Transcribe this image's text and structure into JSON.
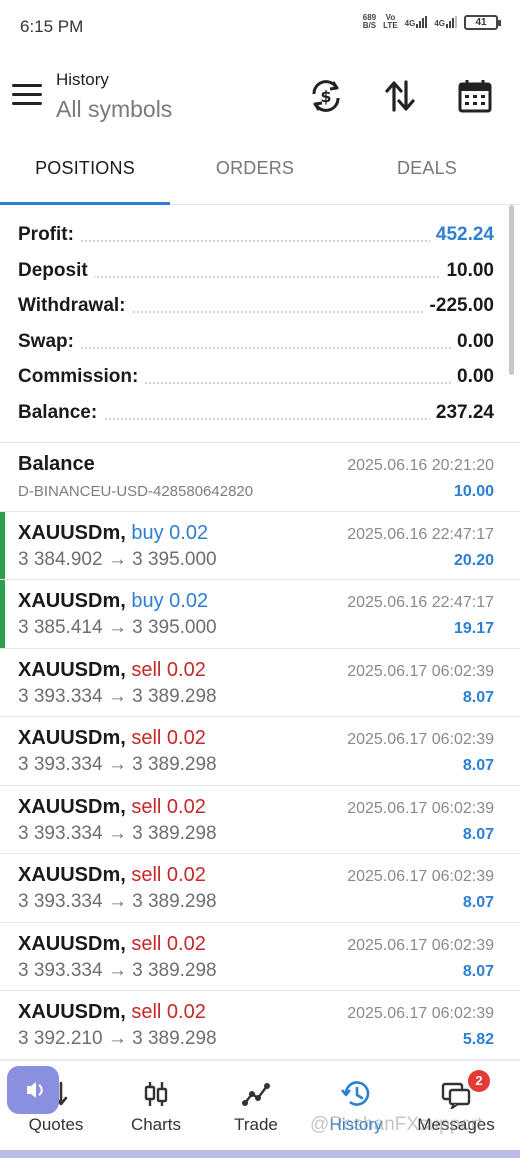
{
  "status_bar": {
    "time": "6:15 PM",
    "speed_value": "689",
    "speed_unit": "B/S",
    "volte_top": "Vo",
    "volte_bottom": "LTE",
    "net1": "4G",
    "net2": "4G",
    "battery": "41"
  },
  "header": {
    "title": "History",
    "subtitle": "All symbols"
  },
  "tabs": [
    {
      "label": "POSITIONS",
      "active": true
    },
    {
      "label": "ORDERS",
      "active": false
    },
    {
      "label": "DEALS",
      "active": false
    }
  ],
  "summary": [
    {
      "label": "Profit:",
      "value": "452.24",
      "color": "#2d7fd3"
    },
    {
      "label": "Deposit",
      "value": "10.00",
      "color": "#1a1a1a"
    },
    {
      "label": "Withdrawal:",
      "value": "-225.00",
      "color": "#1a1a1a"
    },
    {
      "label": "Swap:",
      "value": "0.00",
      "color": "#1a1a1a"
    },
    {
      "label": "Commission:",
      "value": "0.00",
      "color": "#1a1a1a"
    },
    {
      "label": "Balance:",
      "value": "237.24",
      "color": "#1a1a1a"
    }
  ],
  "balance_entry": {
    "title": "Balance",
    "account": "D-BINANCEU-USD-428580642820",
    "time": "2025.06.16 20:21:20",
    "value": "10.00"
  },
  "trades": [
    {
      "symbol": "XAUUSDm,",
      "type": "buy 0.02",
      "side": "buy",
      "open": "3 384.902",
      "arrow": "→",
      "close": "3 395.000",
      "time": "2025.06.16 22:47:17",
      "profit": "20.20"
    },
    {
      "symbol": "XAUUSDm,",
      "type": "buy 0.02",
      "side": "buy",
      "open": "3 385.414",
      "arrow": "→",
      "close": "3 395.000",
      "time": "2025.06.16 22:47:17",
      "profit": "19.17"
    },
    {
      "symbol": "XAUUSDm,",
      "type": "sell 0.02",
      "side": "sell",
      "open": "3 393.334",
      "arrow": "→",
      "close": "3 389.298",
      "time": "2025.06.17 06:02:39",
      "profit": "8.07"
    },
    {
      "symbol": "XAUUSDm,",
      "type": "sell 0.02",
      "side": "sell",
      "open": "3 393.334",
      "arrow": "→",
      "close": "3 389.298",
      "time": "2025.06.17 06:02:39",
      "profit": "8.07"
    },
    {
      "symbol": "XAUUSDm,",
      "type": "sell 0.02",
      "side": "sell",
      "open": "3 393.334",
      "arrow": "→",
      "close": "3 389.298",
      "time": "2025.06.17 06:02:39",
      "profit": "8.07"
    },
    {
      "symbol": "XAUUSDm,",
      "type": "sell 0.02",
      "side": "sell",
      "open": "3 393.334",
      "arrow": "→",
      "close": "3 389.298",
      "time": "2025.06.17 06:02:39",
      "profit": "8.07"
    },
    {
      "symbol": "XAUUSDm,",
      "type": "sell 0.02",
      "side": "sell",
      "open": "3 393.334",
      "arrow": "→",
      "close": "3 389.298",
      "time": "2025.06.17 06:02:39",
      "profit": "8.07"
    },
    {
      "symbol": "XAUUSDm,",
      "type": "sell 0.02",
      "side": "sell",
      "open": "3 392.210",
      "arrow": "→",
      "close": "3 389.298",
      "time": "2025.06.17 06:02:39",
      "profit": "5.82"
    }
  ],
  "bottom_nav": [
    {
      "label": "Quotes",
      "icon": "quotes-icon",
      "active": false
    },
    {
      "label": "Charts",
      "icon": "charts-icon",
      "active": false
    },
    {
      "label": "Trade",
      "icon": "trade-icon",
      "active": false
    },
    {
      "label": "History",
      "icon": "history-icon",
      "active": true
    },
    {
      "label": "Messages",
      "icon": "messages-icon",
      "active": false,
      "badge": "2"
    }
  ],
  "watermark": "@RoshanFXsupport",
  "colors": {
    "accent_blue": "#2d7fd3",
    "sell_red": "#c62828",
    "buy_marker_green": "#2e9e4f"
  }
}
